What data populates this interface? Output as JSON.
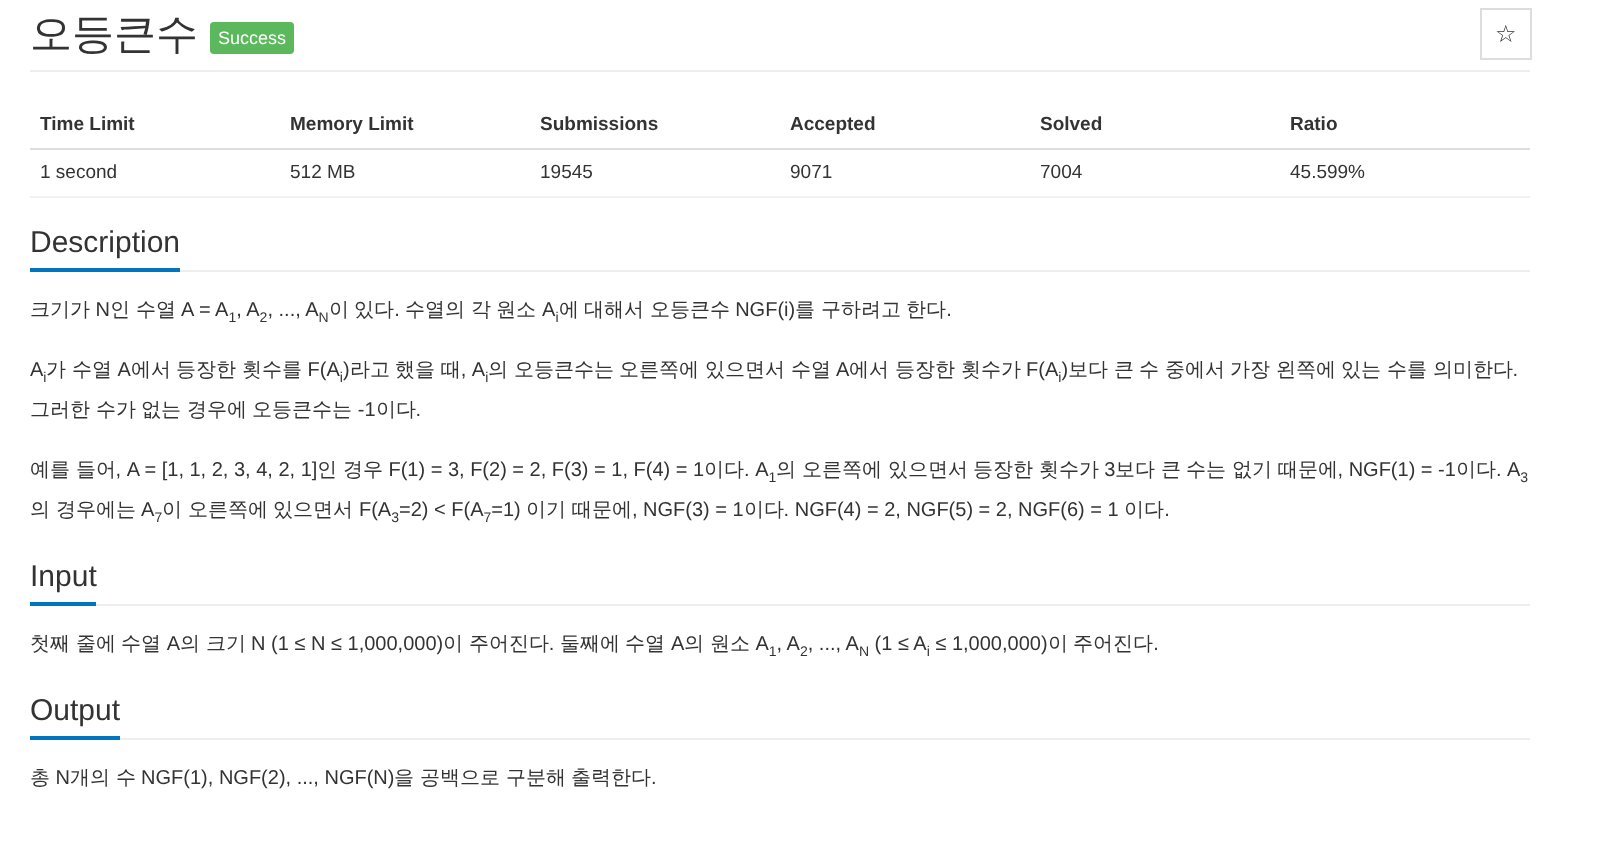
{
  "title": "오등큰수",
  "badge": "Success",
  "star_button": "☆",
  "stats": {
    "columns": [
      "Time Limit",
      "Memory Limit",
      "Submissions",
      "Accepted",
      "Solved",
      "Ratio"
    ],
    "values": [
      "1 second",
      "512 MB",
      "19545",
      "9071",
      "7004",
      "45.599%"
    ]
  },
  "sections": [
    {
      "heading": "Description",
      "paragraphs": [
        "크기가 N인 수열 A = A$_{1}$, A$_{2}$, ..., A$_{N}$이 있다. 수열의 각 원소 A$_{i}$에 대해서 오등큰수 NGF(i)를 구하려고 한다.",
        "A$_{i}$가 수열 A에서 등장한 횟수를 F(A$_{i}$)라고 했을 때, A$_{i}$의 오등큰수는 오른쪽에 있으면서 수열 A에서 등장한 횟수가 F(A$_{i}$)보다 큰 수 중에서 가장 왼쪽에 있는 수를 의미한다. 그러한 수가 없는 경우에 오등큰수는 -1이다.",
        "예를 들어, A = [1, 1, 2, 3, 4, 2, 1]인 경우 F(1) = 3, F(2) = 2, F(3) = 1, F(4) = 1이다. A$_{1}$의 오른쪽에 있으면서 등장한 횟수가 3보다 큰 수는 없기 때문에, NGF(1) = -1이다. A$_{3}$의 경우에는 A$_{7}$이 오른쪽에 있으면서 F(A$_{3}$=2) < F(A$_{7}$=1) 이기 때문에, NGF(3) = 1이다. NGF(4) = 2, NGF(5) = 2, NGF(6) = 1 이다."
      ]
    },
    {
      "heading": "Input",
      "paragraphs": [
        "첫째 줄에 수열 A의 크기 N (1 ≤ N ≤ 1,000,000)이 주어진다. 둘째에 수열 A의 원소 A$_{1}$, A$_{2}$, ..., A$_{N}$ (1 ≤ A$_{i}$ ≤ 1,000,000)이 주어진다."
      ]
    },
    {
      "heading": "Output",
      "paragraphs": [
        "총 N개의 수 NGF(1), NGF(2), ..., NGF(N)을 공백으로 구분해 출력한다."
      ]
    }
  ]
}
